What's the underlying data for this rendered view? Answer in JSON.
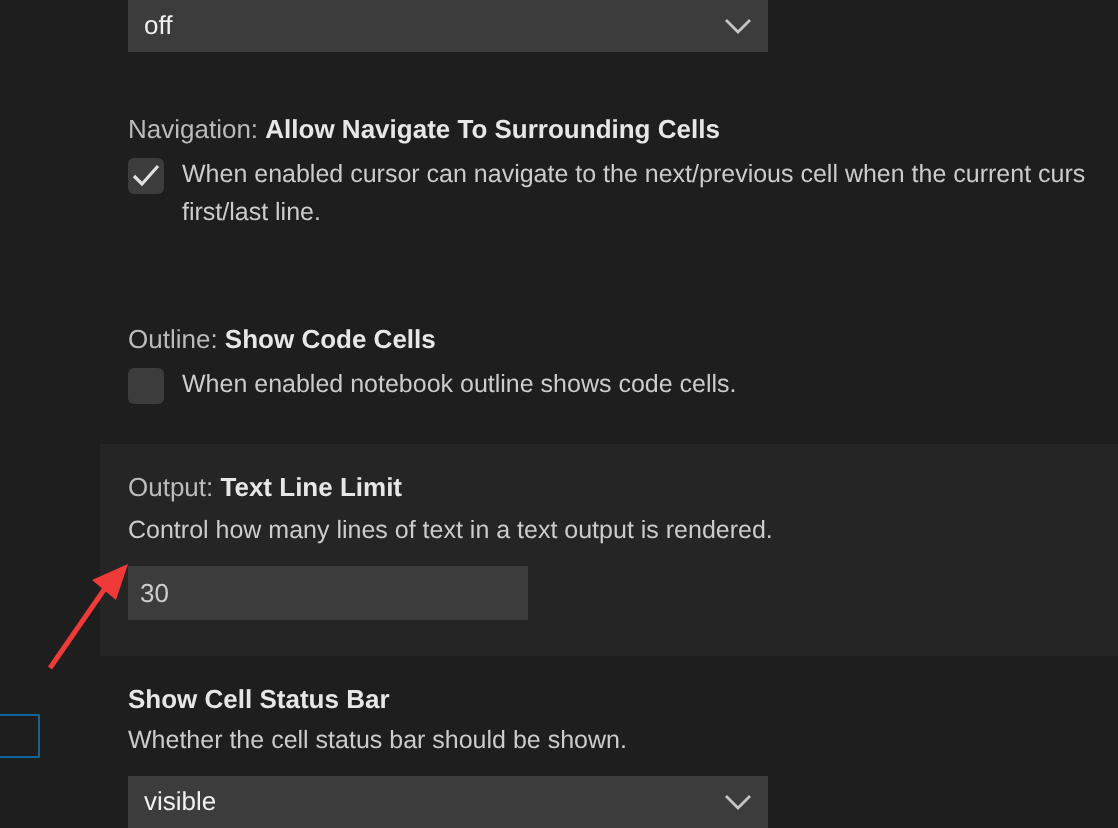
{
  "settings": [
    {
      "kind": "select",
      "value": "off",
      "focused": false
    },
    {
      "kind": "checkbox",
      "category": "Navigation: ",
      "title": "Allow Navigate To Surrounding Cells",
      "checked": true,
      "description": [
        "When enabled cursor can navigate to the next/previous cell when the current curs",
        "first/last line."
      ],
      "focused": false
    },
    {
      "kind": "checkbox",
      "category": "Outline: ",
      "title": "Show Code Cells",
      "checked": false,
      "description": [
        "When enabled notebook outline shows code cells."
      ],
      "focused": false
    },
    {
      "kind": "number",
      "category": "Output: ",
      "title": "Text Line Limit",
      "description": [
        "Control how many lines of text in a text output is rendered."
      ],
      "value": "30",
      "focused": true
    },
    {
      "kind": "select",
      "title": "Show Cell Status Bar",
      "description": [
        "Whether the cell status bar should be shown."
      ],
      "value": "visible",
      "focused": false
    }
  ]
}
